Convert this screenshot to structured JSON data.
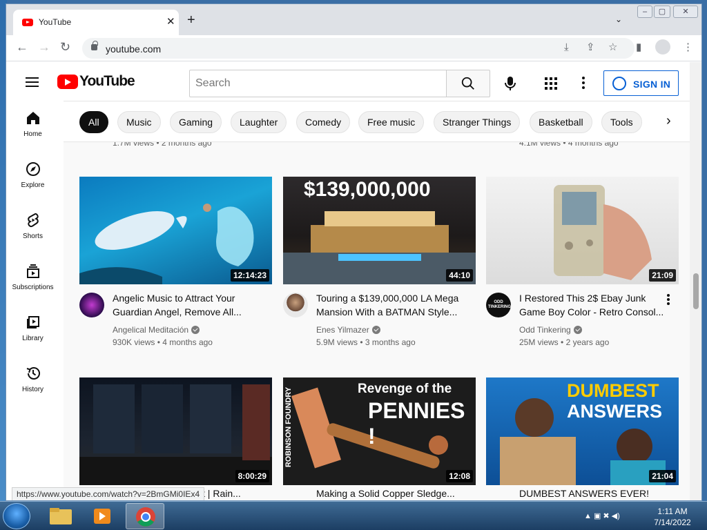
{
  "browser": {
    "tab_title": "YouTube",
    "tab_close": "✕",
    "new_tab": "+",
    "tab_search": "⌄",
    "url": "youtube.com",
    "status_url": "https://www.youtube.com/watch?v=2BmGMi0IEx4"
  },
  "youtube": {
    "logo_text": "YouTube",
    "search_placeholder": "Search",
    "sign_in": "SIGN IN",
    "chips": [
      "All",
      "Music",
      "Gaming",
      "Laughter",
      "Comedy",
      "Free music",
      "Stranger Things",
      "Basketball",
      "Tools"
    ],
    "active_chip": "All",
    "sidebar": [
      {
        "label": "Home",
        "icon": "home-icon"
      },
      {
        "label": "Explore",
        "icon": "compass-icon"
      },
      {
        "label": "Shorts",
        "icon": "shorts-icon"
      },
      {
        "label": "Subscriptions",
        "icon": "subscriptions-icon"
      },
      {
        "label": "Library",
        "icon": "library-icon"
      },
      {
        "label": "History",
        "icon": "history-icon"
      }
    ],
    "partial_meta_left": "1.7M views • 2 months ago",
    "partial_meta_right": "4.1M views • 4 months ago",
    "videos": [
      {
        "title": "Angelic Music to Attract Your Guardian Angel, Remove All...",
        "channel": "Angelical Meditación",
        "views": "930K views",
        "age": "4 months ago",
        "duration": "12:14:23"
      },
      {
        "title": "Touring a $139,000,000 LA Mega Mansion With a BATMAN Style...",
        "channel": "Enes Yilmazer",
        "views": "5.9M views",
        "age": "3 months ago",
        "duration": "44:10",
        "thumb_text": "$139,000,000"
      },
      {
        "title": "I Restored This 2$ Ebay Junk Game Boy Color - Retro Consol...",
        "channel": "Odd Tinkering",
        "views": "25M views",
        "age": "2 years ago",
        "duration": "21:09",
        "avatar_text": "ODD TINKERING"
      },
      {
        "title": "...partment | Rain...",
        "duration": "8:00:29"
      },
      {
        "title": "Making a Solid Copper Sledge...",
        "duration": "12:08",
        "thumb_text_1": "Revenge of the",
        "thumb_text_2": "PENNIES !",
        "thumb_side": "ROBINSON FOUNDRY"
      },
      {
        "title": "DUMBEST ANSWERS EVER!",
        "duration": "21:04",
        "thumb_text_1": "DUMBEST",
        "thumb_text_2": "ANSWERS"
      }
    ]
  },
  "taskbar": {
    "time": "1:11 AM",
    "date": "7/14/2022"
  }
}
